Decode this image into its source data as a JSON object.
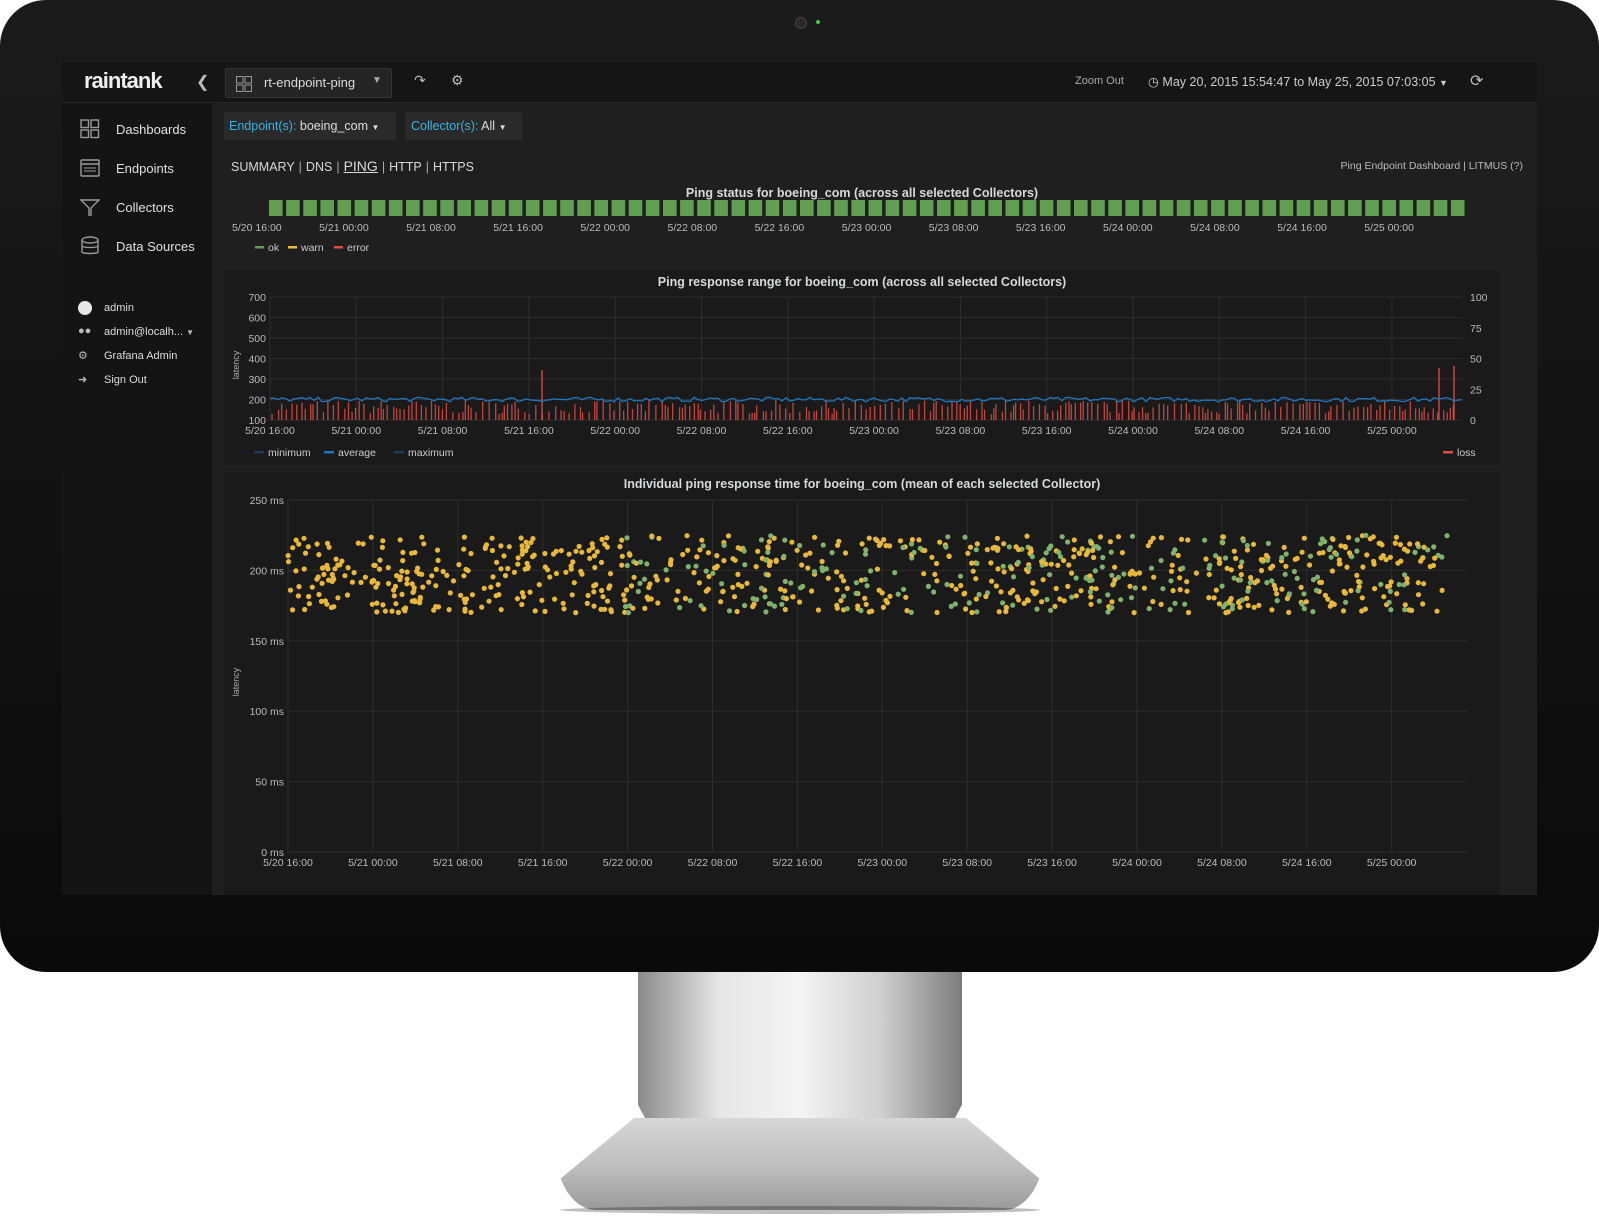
{
  "topbar": {
    "logo": "raintank",
    "dashboard_name": "rt-endpoint-ping",
    "zoom_out": "Zoom Out",
    "time_range": "May 20, 2015 15:54:47 to May 25, 2015 07:03:05"
  },
  "sidebar": {
    "nav": [
      {
        "label": "Dashboards",
        "icon": "dashboards-icon"
      },
      {
        "label": "Endpoints",
        "icon": "endpoints-icon"
      },
      {
        "label": "Collectors",
        "icon": "collectors-icon"
      },
      {
        "label": "Data Sources",
        "icon": "data-sources-icon"
      }
    ],
    "user": [
      {
        "label": "admin",
        "icon": "user-avatar-icon"
      },
      {
        "label": "admin@localh...",
        "icon": "org-icon"
      },
      {
        "label": "Grafana Admin",
        "icon": "gear-icon"
      },
      {
        "label": "Sign Out",
        "icon": "sign-out-icon"
      }
    ]
  },
  "filters": {
    "endpoint_key": "Endpoint(s):",
    "endpoint_value": "boeing_com",
    "collector_key": "Collector(s):",
    "collector_value": "All"
  },
  "tabs": [
    "SUMMARY",
    "DNS",
    "PING",
    "HTTP",
    "HTTPS"
  ],
  "active_tab": "PING",
  "dash_links": "Ping Endpoint Dashboard | LITMUS (?)",
  "colors": {
    "ok": "#629e51",
    "warn": "#eab839",
    "error": "#e24d42",
    "blue": "#1f78c1",
    "green_dot": "#7eb26d"
  },
  "x_ticks": [
    "5/20 16:00",
    "5/21 00:00",
    "5/21 08:00",
    "5/21 16:00",
    "5/22 00:00",
    "5/22 08:00",
    "5/22 16:00",
    "5/23 00:00",
    "5/23 08:00",
    "5/23 16:00",
    "5/24 00:00",
    "5/24 08:00",
    "5/24 16:00",
    "5/25 00:00"
  ],
  "chart_data": [
    {
      "type": "heatmap",
      "title": "Ping status for boeing_com (across all selected Collectors)",
      "legend": [
        "ok",
        "warn",
        "error"
      ],
      "status_blocks": 70,
      "status": "ok"
    },
    {
      "type": "line",
      "title": "Ping response range for boeing_com (across all selected Collectors)",
      "ylabel": "latency",
      "ylim": [
        100,
        700
      ],
      "y_ticks": [
        "700",
        "600",
        "500",
        "400",
        "300",
        "200",
        "100"
      ],
      "y2lim": [
        0,
        100
      ],
      "y2_ticks": [
        "100",
        "75",
        "50",
        "25",
        "0"
      ],
      "series": [
        {
          "name": "minimum"
        },
        {
          "name": "average",
          "approx_value": 200
        },
        {
          "name": "maximum"
        },
        {
          "name": "loss",
          "axis": "right"
        }
      ],
      "legend": [
        "minimum",
        "average",
        "maximum"
      ],
      "legend_right": [
        "loss"
      ],
      "grid": true
    },
    {
      "type": "scatter",
      "title": "Individual ping response time for boeing_com (mean of each selected Collector)",
      "ylabel": "latency",
      "ylim": [
        0,
        250
      ],
      "y_ticks": [
        "250 ms",
        "200 ms",
        "150 ms",
        "100 ms",
        "50 ms",
        "0 ms"
      ],
      "value_range": [
        170,
        225
      ],
      "grid": true
    }
  ]
}
